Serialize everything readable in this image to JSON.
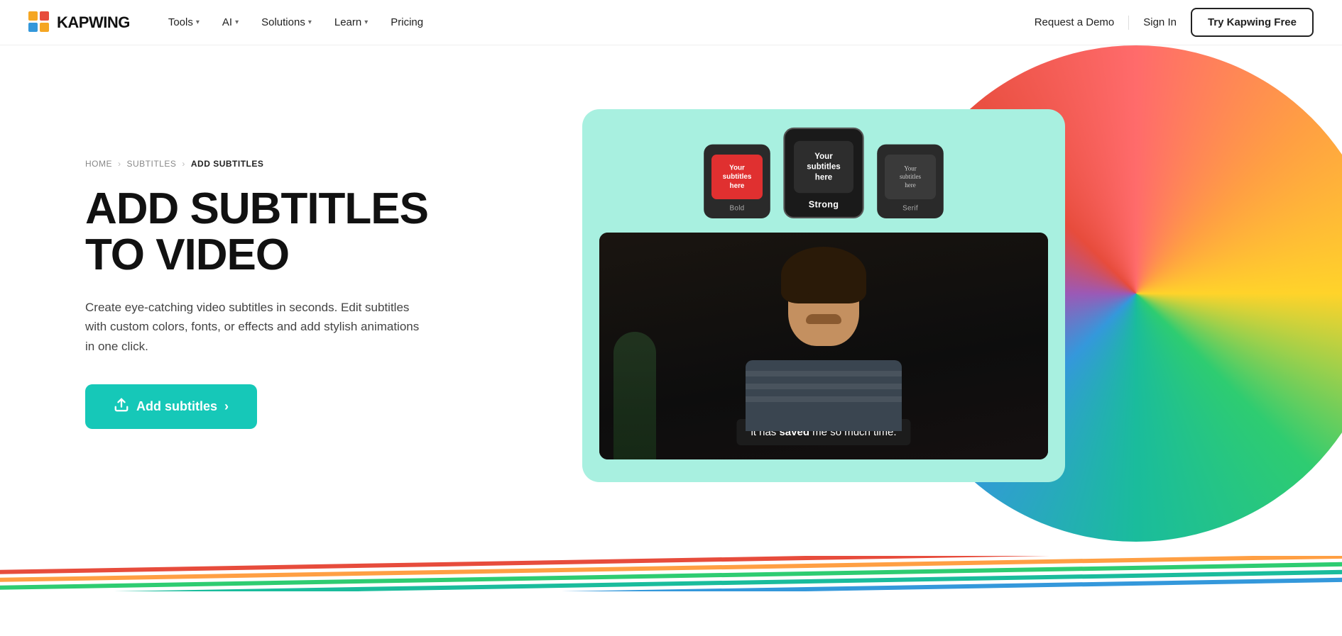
{
  "navbar": {
    "logo_text": "KAPWING",
    "nav_items": [
      {
        "label": "Tools",
        "has_dropdown": true
      },
      {
        "label": "AI",
        "has_dropdown": true
      },
      {
        "label": "Solutions",
        "has_dropdown": true
      },
      {
        "label": "Learn",
        "has_dropdown": true
      },
      {
        "label": "Pricing",
        "has_dropdown": false
      }
    ],
    "request_demo": "Request a Demo",
    "sign_in": "Sign In",
    "try_free": "Try Kapwing Free"
  },
  "breadcrumb": {
    "items": [
      "HOME",
      "SUBTITLES",
      "ADD SUBTITLES"
    ]
  },
  "hero": {
    "title_line1": "ADD SUBTITLES",
    "title_line2": "TO VIDEO",
    "description": "Create eye-catching video subtitles in seconds. Edit subtitles with custom colors, fonts, or effects and add stylish animations in one click.",
    "cta_label": "Add subtitles"
  },
  "style_cards": [
    {
      "label": "Bold",
      "style": "bold",
      "preview_text": "Your subtitles here",
      "selected": false
    },
    {
      "label": "Strong",
      "style": "strong",
      "preview_text": "Your subtitles here",
      "selected": true
    },
    {
      "label": "Serif",
      "style": "serif",
      "preview_text": "Your subtitles here",
      "selected": false
    }
  ],
  "subtitle_text": {
    "normal": "it has ",
    "bold": "saved",
    "normal2": " me so much time."
  },
  "colors": {
    "teal": "#16c8b8",
    "mint_card_bg": "#a8f0e0",
    "navbar_bg": "#ffffff"
  },
  "bottom_stripes": [
    "#ff6b6b",
    "#ff9f43",
    "#2ecc71",
    "#1abc9c",
    "#3498db"
  ],
  "icons": {
    "upload": "⬆",
    "arrow_right": "›",
    "chevron_down": "▾"
  }
}
